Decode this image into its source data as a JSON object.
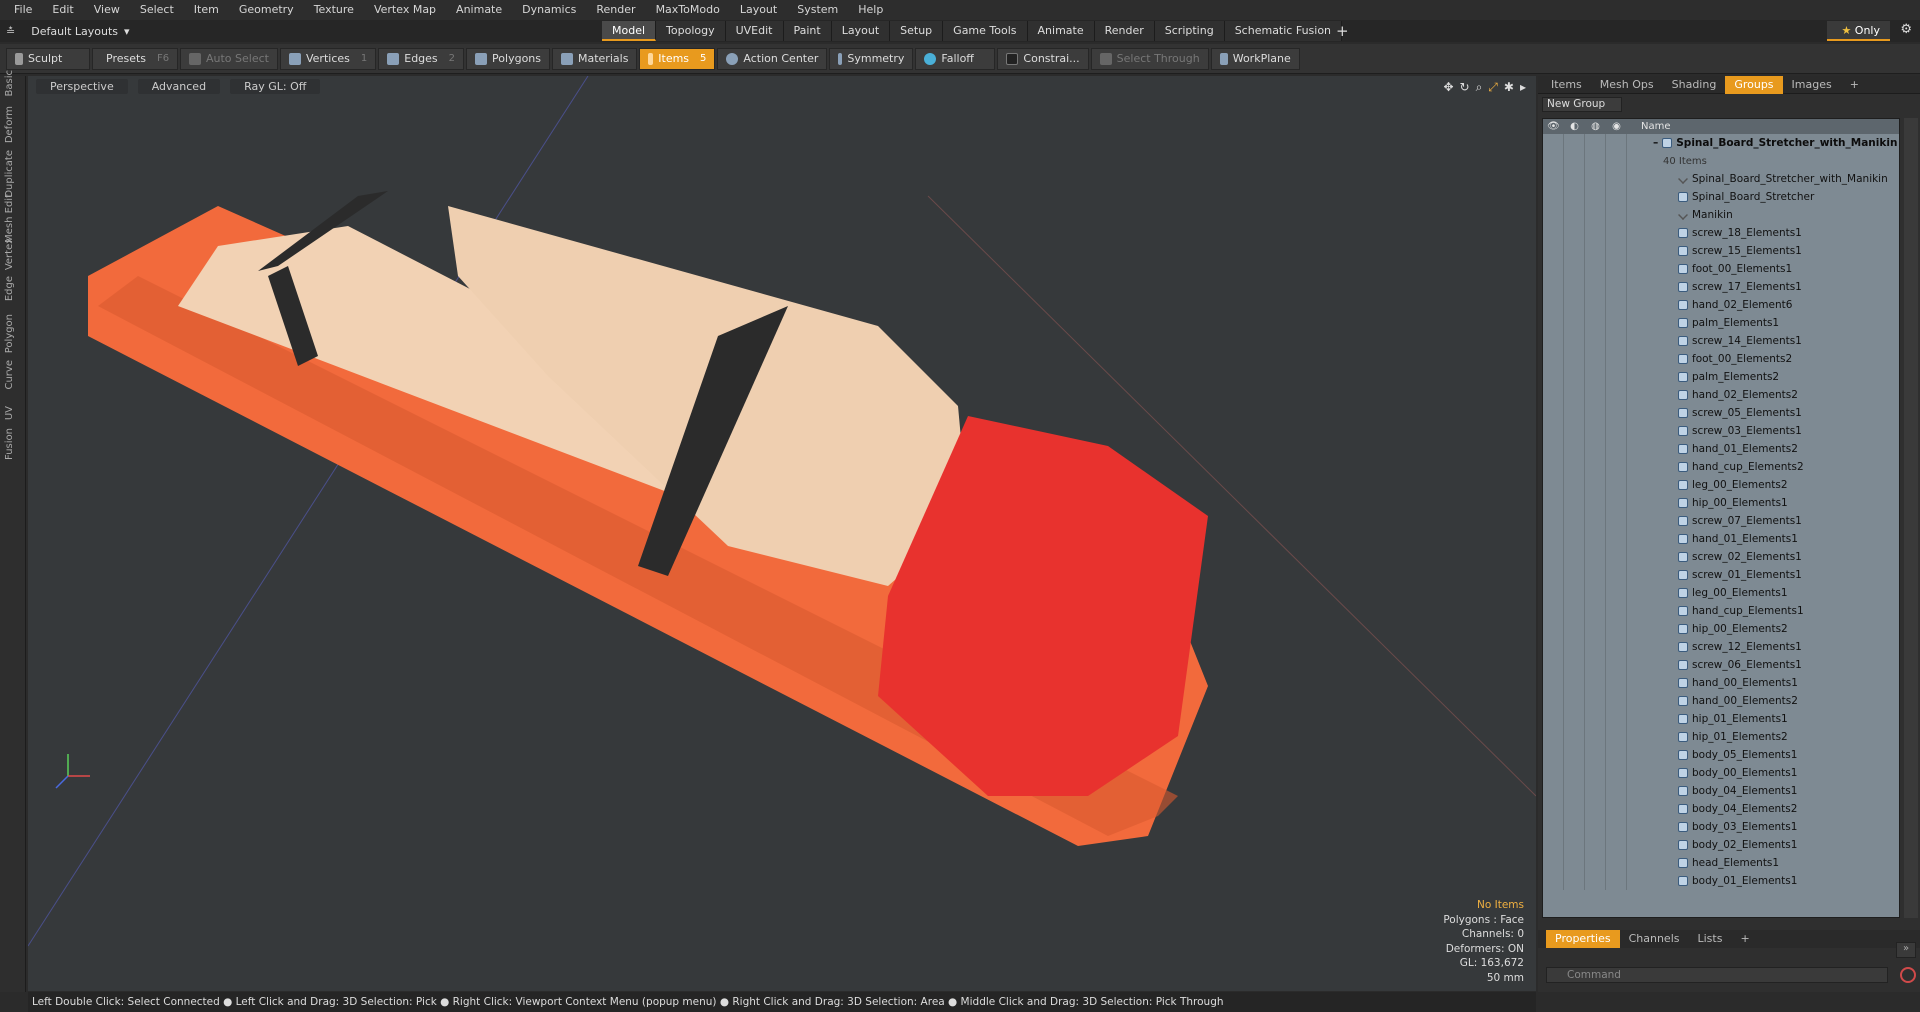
{
  "menu": [
    "File",
    "Edit",
    "View",
    "Select",
    "Item",
    "Geometry",
    "Texture",
    "Vertex Map",
    "Animate",
    "Dynamics",
    "Render",
    "MaxToModo",
    "Layout",
    "System",
    "Help"
  ],
  "layout_dropdown": "Default Layouts",
  "mode_tabs": [
    "Model",
    "Topology",
    "UVEdit",
    "Paint",
    "Layout",
    "Setup",
    "Game Tools",
    "Animate",
    "Render",
    "Scripting",
    "Schematic Fusion"
  ],
  "active_mode_tab": "Model",
  "only_label": "Only",
  "toolbar": {
    "sculpt": "Sculpt",
    "presets": "Presets",
    "presets_key": "F6",
    "auto_select": "Auto Select",
    "vertices": "Vertices",
    "vertices_key": "1",
    "edges": "Edges",
    "edges_key": "2",
    "polygons": "Polygons",
    "materials": "Materials",
    "items": "Items",
    "items_key": "5",
    "action_center": "Action Center",
    "symmetry": "Symmetry",
    "falloff": "Falloff",
    "constrain": "Constrai...",
    "select_through": "Select Through",
    "workplane": "WorkPlane"
  },
  "left_tabs": [
    "Basic",
    "Deform",
    "Duplicate",
    "Mesh Edit",
    "Vertex",
    "Edge",
    "Polygon",
    "Curve",
    "UV",
    "Fusion"
  ],
  "viewport": {
    "perspective": "Perspective",
    "advanced": "Advanced",
    "raygl": "Ray GL: Off"
  },
  "stats": {
    "no_items": "No Items",
    "polygons": "Polygons : Face",
    "channels": "Channels: 0",
    "deformers": "Deformers: ON",
    "gl": "GL: 163,672",
    "focal": "50 mm"
  },
  "status_bar": "Left Double Click: Select Connected ● Left Click and Drag: 3D Selection: Pick ● Right Click: Viewport Context Menu (popup menu) ● Right Click and Drag: 3D Selection: Area ● Middle Click and Drag: 3D Selection: Pick Through",
  "right_tabs": [
    "Items",
    "Mesh Ops",
    "Shading",
    "Groups",
    "Images"
  ],
  "active_right_tab": "Groups",
  "new_group": "New Group",
  "list_header": "Name",
  "root_group": "Spinal_Board_Stretcher_with_Manikin",
  "root_count": "40 Items",
  "list_items": [
    "Spinal_Board_Stretcher_with_Manikin",
    "Spinal_Board_Stretcher",
    "Manikin",
    "screw_18_Elements1",
    "screw_15_Elements1",
    "foot_00_Elements1",
    "screw_17_Elements1",
    "hand_02_Element6",
    "palm_Elements1",
    "screw_14_Elements1",
    "foot_00_Elements2",
    "palm_Elements2",
    "hand_02_Elements2",
    "screw_05_Elements1",
    "screw_03_Elements1",
    "hand_01_Elements2",
    "hand_cup_Elements2",
    "leg_00_Elements2",
    "hip_00_Elements1",
    "screw_07_Elements1",
    "hand_01_Elements1",
    "screw_02_Elements1",
    "screw_01_Elements1",
    "leg_00_Elements1",
    "hand_cup_Elements1",
    "hip_00_Elements2",
    "screw_12_Elements1",
    "screw_06_Elements1",
    "hand_00_Elements1",
    "hand_00_Elements2",
    "hip_01_Elements1",
    "hip_01_Elements2",
    "body_05_Elements1",
    "body_00_Elements1",
    "body_04_Elements1",
    "body_04_Elements2",
    "body_03_Elements1",
    "body_02_Elements1",
    "head_Elements1",
    "body_01_Elements1"
  ],
  "bottom_tabs": [
    "Properties",
    "Channels",
    "Lists"
  ],
  "active_bottom_tab": "Properties",
  "command_placeholder": "Command",
  "colors": {
    "accent": "#e89a1e",
    "stretcher": "#f26a3c",
    "head_block": "#e8322e",
    "manikin": "#f2d2b4",
    "strap": "#2b2b2b"
  }
}
